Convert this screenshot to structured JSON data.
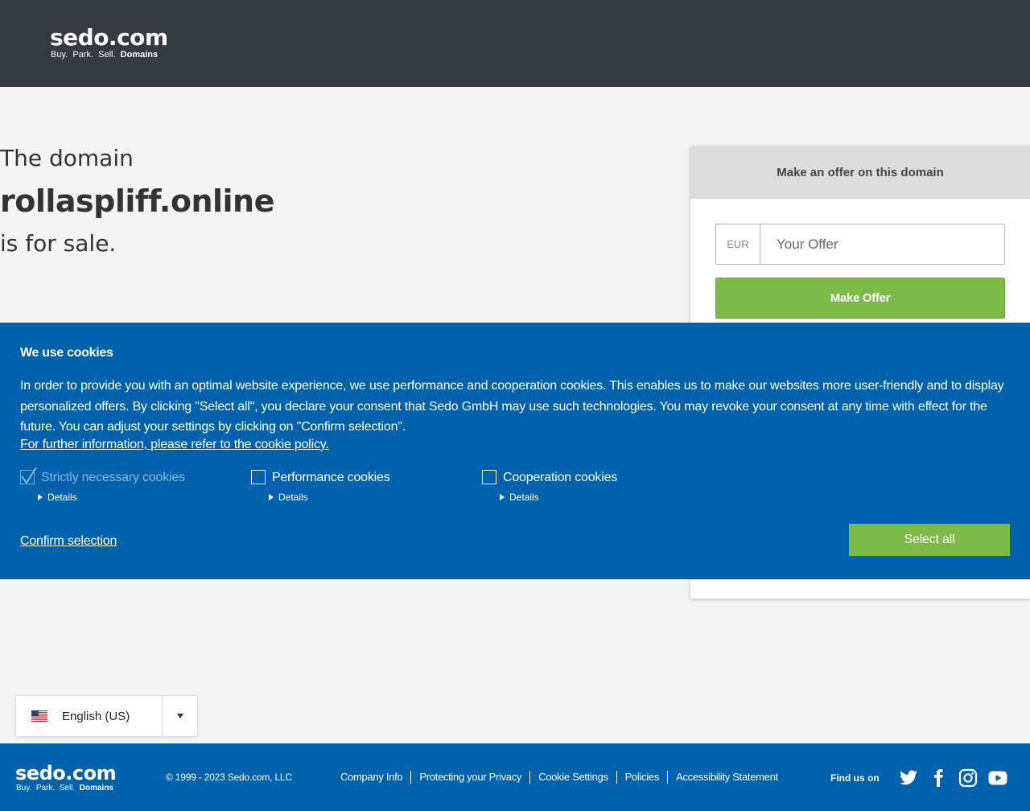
{
  "header": {
    "logo_main": "sedo.com",
    "logo_tag_words": [
      "Buy.",
      "Park.",
      "Sell."
    ],
    "logo_tag_bold": "Domains"
  },
  "hero": {
    "line1": "The domain",
    "domain": "rollaspliff.online",
    "line3": "is for sale."
  },
  "offer": {
    "heading": "Make an offer on this domain",
    "currency": "EUR",
    "placeholder": "Your Offer",
    "button_label": "Make Offer"
  },
  "cookies": {
    "title": "We use cookies",
    "body": "In order to provide you with an optimal website experience, we use performance and cooperation cookies. This enables us to make our websites more user-friendly and to display personalized offers. By clicking \"Select all\", you declare your consent that Sedo GmbH may use such technologies. You may revoke your consent at any time with effect for the future. You can adjust your settings by clicking on \"Confirm selection\".",
    "policy_link": "For further information, please refer to the cookie policy.",
    "options": [
      {
        "label": "Strictly necessary cookies",
        "checked": true,
        "disabled": true,
        "details": "Details"
      },
      {
        "label": "Performance cookies",
        "checked": false,
        "disabled": false,
        "details": "Details"
      },
      {
        "label": "Cooperation cookies",
        "checked": false,
        "disabled": false,
        "details": "Details"
      }
    ],
    "confirm_label": "Confirm selection",
    "select_all_label": "Select all"
  },
  "language": {
    "selected": "English (US)"
  },
  "footer": {
    "logo_main": "sedo.com",
    "logo_tag_words": [
      "Buy.",
      "Park.",
      "Sell."
    ],
    "logo_tag_bold": "Domains",
    "copyright": "© 1999 - 2023 Sedo.com, LLC",
    "links": [
      "Company Info",
      "Protecting your Privacy",
      "Cookie Settings",
      "Policies",
      "Accessibility Statement"
    ],
    "find_us": "Find us on",
    "social_icons": [
      "twitter-icon",
      "facebook-icon",
      "instagram-icon",
      "youtube-icon"
    ]
  },
  "colors": {
    "header_bg": "#353940",
    "banner_blue": "#0062ad",
    "accent_green": "#7cbb48"
  }
}
